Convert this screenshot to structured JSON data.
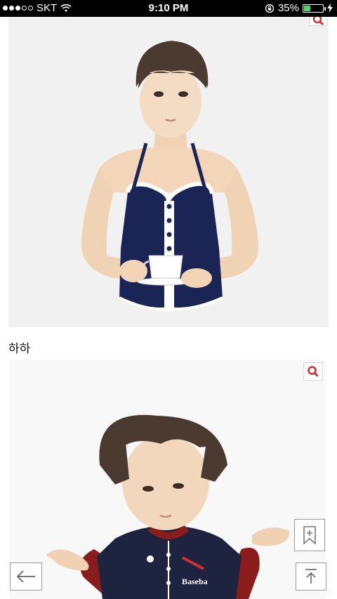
{
  "status_bar": {
    "carrier": "SKT",
    "time": "9:10 PM",
    "battery": "35%",
    "battery_level": 0.35,
    "signal_bars": 3,
    "icons": [
      "signal-dots-icon",
      "wifi-icon",
      "rotation-lock-icon",
      "battery-icon",
      "charging-bolt-icon"
    ]
  },
  "post": {
    "caption": "하하"
  },
  "images": [
    {
      "name": "avatar-swimsuit-image",
      "zoom_icon": "magnifier-icon"
    },
    {
      "name": "avatar-baseball-image",
      "zoom_icon": "magnifier-icon",
      "shirt_text": "Baseba"
    }
  ],
  "floating_buttons": [
    "back-arrow-icon",
    "bookmark-add-icon",
    "scroll-top-icon"
  ],
  "colors": {
    "accent_red": "#d22f2f",
    "battery_green": "#4cd964",
    "swimsuit_navy": "#1a2556",
    "hair_brown": "#4a3a30"
  }
}
